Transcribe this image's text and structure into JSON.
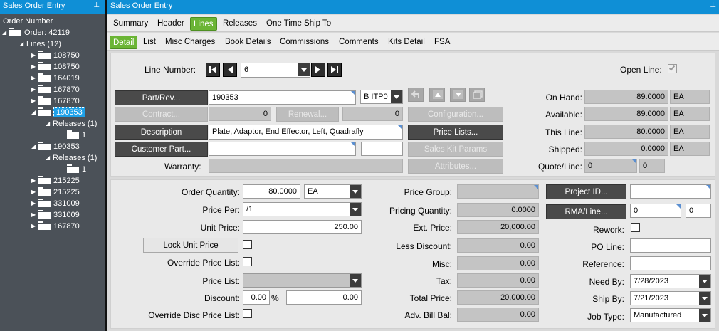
{
  "left_panel": {
    "title": "Sales Order Entry",
    "pin": "⊥",
    "tree": {
      "header": "Order Number",
      "order": "Order: 42119",
      "lines": "Lines (12)",
      "items": [
        "108750",
        "108750",
        "164019",
        "167870",
        "167870",
        "190353",
        "Releases (1)",
        "1",
        "190353",
        "Releases (1)",
        "1",
        "215225",
        "215225",
        "331009",
        "331009",
        "167870"
      ]
    }
  },
  "main": {
    "title": "Sales Order Entry",
    "pin": "⊥",
    "tabs": [
      "Summary",
      "Header",
      "Lines",
      "Releases",
      "One Time Ship To"
    ],
    "subtabs": [
      "Detail",
      "List",
      "Misc Charges",
      "Book Details",
      "Commissions",
      "Comments",
      "Kits Detail",
      "FSA"
    ]
  },
  "line_nav": {
    "label": "Line Number:",
    "value": "6",
    "open_line_label": "Open Line:"
  },
  "part": {
    "part_rev_button": "Part/Rev...",
    "part_value": "190353",
    "rev_value": "B  ITP0",
    "contract_button": "Contract...",
    "contract_value": "0",
    "renewal_button": "Renewal...",
    "renewal_value": "0",
    "configuration_button": "Configuration...",
    "description_button": "Description",
    "description_value": "Plate, Adaptor, End Effector, Left, Quadrafly",
    "price_lists_button": "Price Lists...",
    "customer_part_button": "Customer Part...",
    "sales_kit_button": "Sales Kit Params",
    "warranty_label": "Warranty:",
    "attributes_button": "Attributes..."
  },
  "inventory": {
    "on_hand_label": "On Hand:",
    "on_hand": "89.0000",
    "on_hand_uom": "EA",
    "available_label": "Available:",
    "available": "89.0000",
    "available_uom": "EA",
    "this_line_label": "This Line:",
    "this_line": "80.0000",
    "this_line_uom": "EA",
    "shipped_label": "Shipped:",
    "shipped": "0.0000",
    "shipped_uom": "EA",
    "quote_line_label": "Quote/Line:",
    "quote": "0",
    "quote_line": "0"
  },
  "pricing": {
    "order_qty_label": "Order Quantity:",
    "order_qty": "80.0000",
    "order_uom": "EA",
    "price_per_label": "Price Per:",
    "price_per": "/1",
    "unit_price_label": "Unit Price:",
    "unit_price": "250.00",
    "lock_unit_price_button": "Lock Unit Price",
    "override_price_list_label": "Override Price List:",
    "price_list_label": "Price List:",
    "discount_label": "Discount:",
    "discount_pct": "0.00",
    "pct_sign": "%",
    "discount_amt": "0.00",
    "override_disc_label": "Override Disc Price List:"
  },
  "totals": {
    "price_group_label": "Price Group:",
    "pricing_qty_label": "Pricing Quantity:",
    "pricing_qty": "0.0000",
    "ext_price_label": "Ext. Price:",
    "ext_price": "20,000.00",
    "less_discount_label": "Less Discount:",
    "less_discount": "0.00",
    "misc_label": "Misc:",
    "misc": "0.00",
    "tax_label": "Tax:",
    "tax": "0.00",
    "total_price_label": "Total Price:",
    "total_price": "20,000.00",
    "adv_bill_label": "Adv. Bill Bal:",
    "adv_bill": "0.00"
  },
  "project": {
    "project_id_button": "Project ID...",
    "rma_button": "RMA/Line...",
    "rma_value": "0",
    "rma_line": "0",
    "rework_label": "Rework:",
    "po_line_label": "PO Line:",
    "reference_label": "Reference:",
    "need_by_label": "Need By:",
    "need_by": "7/28/2023",
    "ship_by_label": "Ship By:",
    "ship_by": "7/21/2023",
    "job_type_label": "Job Type:",
    "job_type": "Manufactured"
  }
}
